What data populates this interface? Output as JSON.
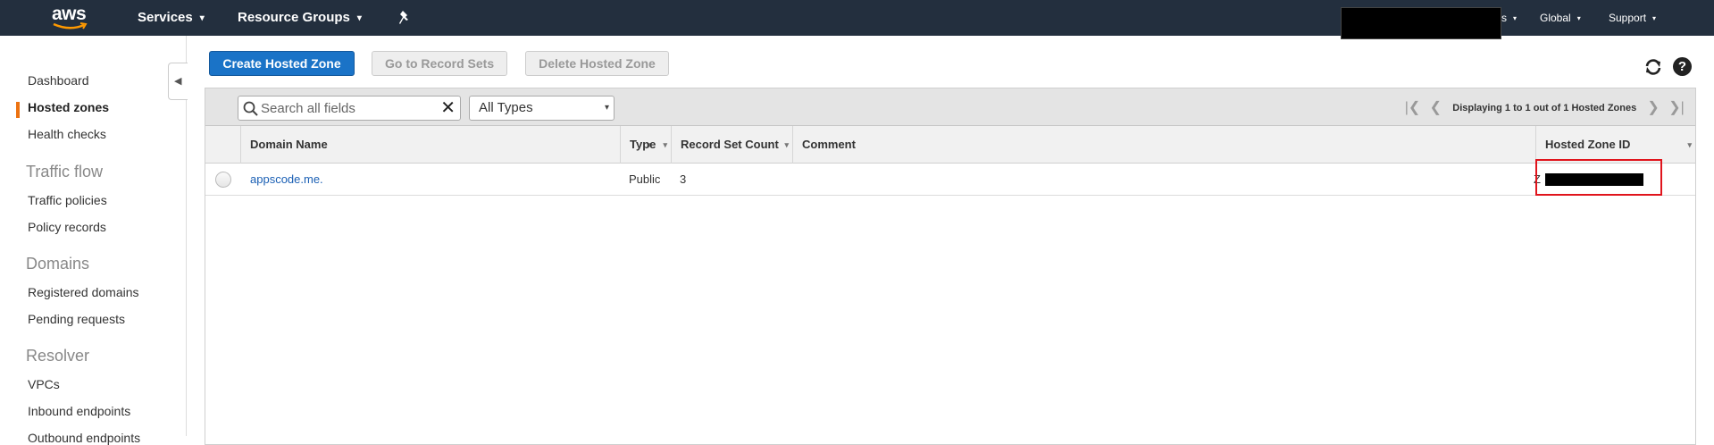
{
  "topnav": {
    "logo": "aws",
    "services": "Services",
    "resource_groups": "Resource Groups",
    "pin_icon": "pin-icon",
    "region": "Global",
    "support": "Support",
    "caret": "▾",
    "account_caret_fragment": "s"
  },
  "sidebar": {
    "items": [
      {
        "label": "Dashboard",
        "type": "link"
      },
      {
        "label": "Hosted zones",
        "type": "link",
        "active": true
      },
      {
        "label": "Health checks",
        "type": "link"
      },
      {
        "label": "Traffic flow",
        "type": "heading"
      },
      {
        "label": "Traffic policies",
        "type": "link"
      },
      {
        "label": "Policy records",
        "type": "link"
      },
      {
        "label": "Domains",
        "type": "heading"
      },
      {
        "label": "Registered domains",
        "type": "link"
      },
      {
        "label": "Pending requests",
        "type": "link"
      },
      {
        "label": "Resolver",
        "type": "heading"
      },
      {
        "label": "VPCs",
        "type": "link"
      },
      {
        "label": "Inbound endpoints",
        "type": "link"
      },
      {
        "label": "Outbound endpoints",
        "type": "link"
      }
    ],
    "accent_color": "#ec7211"
  },
  "actions": {
    "create": "Create Hosted Zone",
    "go_to_records": "Go to Record Sets",
    "delete": "Delete Hosted Zone",
    "refresh_icon": "refresh-icon",
    "help_icon": "help-icon",
    "help_glyph": "?"
  },
  "filter": {
    "search_placeholder": "Search all fields",
    "clear_glyph": "✕",
    "type_selected": "All Types",
    "type_arrow": "▾"
  },
  "pager": {
    "first": "|❮",
    "prev": "❮",
    "text": "Displaying 1 to 1 out of 1 Hosted Zones",
    "next": "❯",
    "last": "❯|"
  },
  "table": {
    "columns": [
      "Domain Name",
      "Type",
      "Record Set Count",
      "Comment",
      "Hosted Zone ID"
    ],
    "sort_glyph": "▾",
    "rows": [
      {
        "domain": "appscode.me.",
        "type": "Public",
        "record_count": "3",
        "comment": "",
        "zone_id": "Z"
      }
    ]
  },
  "colors": {
    "nav_bg": "#232f3e",
    "primary_button": "#1a73c7",
    "highlight": "#e0141c"
  }
}
